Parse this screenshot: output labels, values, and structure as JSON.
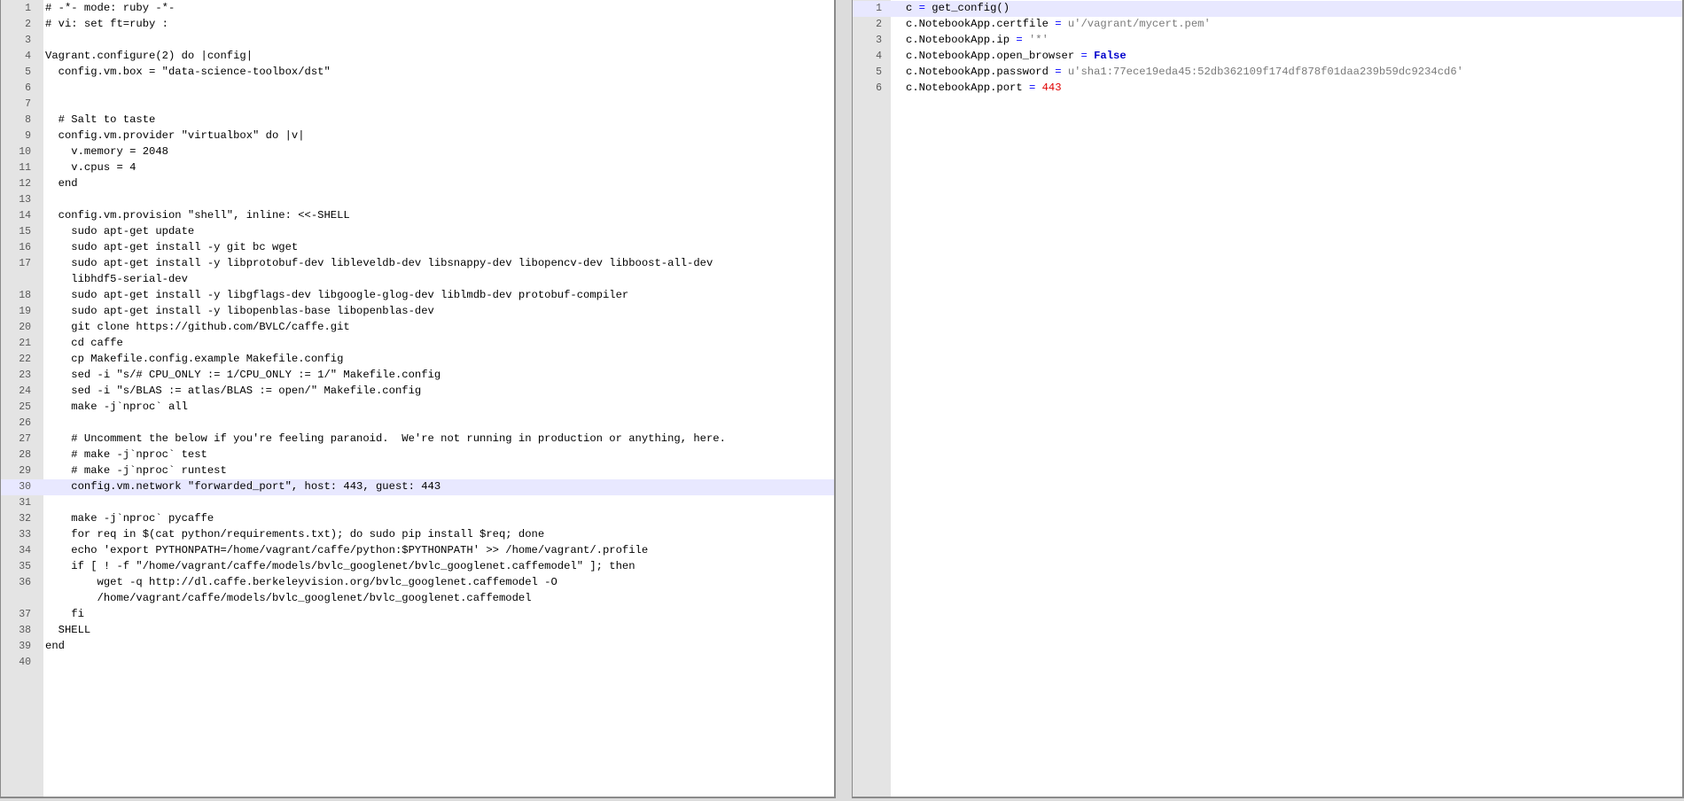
{
  "left_editor": {
    "filename": "",
    "lines": [
      {
        "num": "1",
        "text": "# -*- mode: ruby -*-"
      },
      {
        "num": "2",
        "text": "# vi: set ft=ruby :"
      },
      {
        "num": "3",
        "text": ""
      },
      {
        "num": "4",
        "text": "Vagrant.configure(2) do |config|"
      },
      {
        "num": "5",
        "text": "  config.vm.box = \"data-science-toolbox/dst\""
      },
      {
        "num": "6",
        "text": ""
      },
      {
        "num": "7",
        "text": ""
      },
      {
        "num": "8",
        "text": "  # Salt to taste"
      },
      {
        "num": "9",
        "text": "  config.vm.provider \"virtualbox\" do |v|"
      },
      {
        "num": "10",
        "text": "    v.memory = 2048"
      },
      {
        "num": "11",
        "text": "    v.cpus = 4"
      },
      {
        "num": "12",
        "text": "  end"
      },
      {
        "num": "13",
        "text": ""
      },
      {
        "num": "14",
        "text": "  config.vm.provision \"shell\", inline: <<-SHELL"
      },
      {
        "num": "15",
        "text": "    sudo apt-get update"
      },
      {
        "num": "16",
        "text": "    sudo apt-get install -y git bc wget"
      },
      {
        "num": "17",
        "text": "    sudo apt-get install -y libprotobuf-dev libleveldb-dev libsnappy-dev libopencv-dev libboost-all-dev"
      },
      {
        "num": "",
        "text": "    libhdf5-serial-dev",
        "cont": true
      },
      {
        "num": "18",
        "text": "    sudo apt-get install -y libgflags-dev libgoogle-glog-dev liblmdb-dev protobuf-compiler"
      },
      {
        "num": "19",
        "text": "    sudo apt-get install -y libopenblas-base libopenblas-dev"
      },
      {
        "num": "20",
        "text": "    git clone https://github.com/BVLC/caffe.git"
      },
      {
        "num": "21",
        "text": "    cd caffe"
      },
      {
        "num": "22",
        "text": "    cp Makefile.config.example Makefile.config"
      },
      {
        "num": "23",
        "text": "    sed -i \"s/# CPU_ONLY := 1/CPU_ONLY := 1/\" Makefile.config"
      },
      {
        "num": "24",
        "text": "    sed -i \"s/BLAS := atlas/BLAS := open/\" Makefile.config"
      },
      {
        "num": "25",
        "text": "    make -j`nproc` all"
      },
      {
        "num": "26",
        "text": ""
      },
      {
        "num": "27",
        "text": "    # Uncomment the below if you're feeling paranoid.  We're not running in production or anything, here."
      },
      {
        "num": "28",
        "text": "    # make -j`nproc` test"
      },
      {
        "num": "29",
        "text": "    # make -j`nproc` runtest"
      },
      {
        "num": "30",
        "text": "    config.vm.network \"forwarded_port\", host: 443, guest: 443",
        "highlight": true
      },
      {
        "num": "31",
        "text": ""
      },
      {
        "num": "32",
        "text": "    make -j`nproc` pycaffe"
      },
      {
        "num": "33",
        "text": "    for req in $(cat python/requirements.txt); do sudo pip install $req; done"
      },
      {
        "num": "34",
        "text": "    echo 'export PYTHONPATH=/home/vagrant/caffe/python:$PYTHONPATH' >> /home/vagrant/.profile"
      },
      {
        "num": "35",
        "text": "    if [ ! -f \"/home/vagrant/caffe/models/bvlc_googlenet/bvlc_googlenet.caffemodel\" ]; then"
      },
      {
        "num": "36",
        "text": "        wget -q http://dl.caffe.berkeleyvision.org/bvlc_googlenet.caffemodel -O"
      },
      {
        "num": "",
        "text": "        /home/vagrant/caffe/models/bvlc_googlenet/bvlc_googlenet.caffemodel",
        "cont": true
      },
      {
        "num": "37",
        "text": "    fi"
      },
      {
        "num": "38",
        "text": "  SHELL"
      },
      {
        "num": "39",
        "text": "end"
      },
      {
        "num": "40",
        "text": ""
      }
    ]
  },
  "right_editor": {
    "lines": [
      {
        "num": "1",
        "highlight": true,
        "tokens": [
          [
            "c",
            ""
          ],
          [
            " = ",
            "op"
          ],
          [
            "get_config()",
            ""
          ]
        ]
      },
      {
        "num": "2",
        "tokens": [
          [
            "c.NotebookApp.certfile",
            ""
          ],
          [
            " = ",
            "op"
          ],
          [
            "u'/vagrant/mycert.pem'",
            "str"
          ]
        ]
      },
      {
        "num": "3",
        "tokens": [
          [
            "c.NotebookApp.ip",
            ""
          ],
          [
            " = ",
            "op"
          ],
          [
            "'*'",
            "str"
          ]
        ]
      },
      {
        "num": "4",
        "tokens": [
          [
            "c.NotebookApp.open_browser",
            ""
          ],
          [
            " = ",
            "op"
          ],
          [
            "False",
            "kw"
          ]
        ]
      },
      {
        "num": "5",
        "tokens": [
          [
            "c.NotebookApp.password",
            ""
          ],
          [
            " = ",
            "op"
          ],
          [
            "u'sha1:77ece19eda45:52db362109f174df878f01daa239b59dc9234cd6'",
            "str"
          ]
        ]
      },
      {
        "num": "6",
        "tokens": [
          [
            "c.NotebookApp.port",
            ""
          ],
          [
            " = ",
            "op"
          ],
          [
            "443",
            "num"
          ]
        ]
      }
    ]
  }
}
